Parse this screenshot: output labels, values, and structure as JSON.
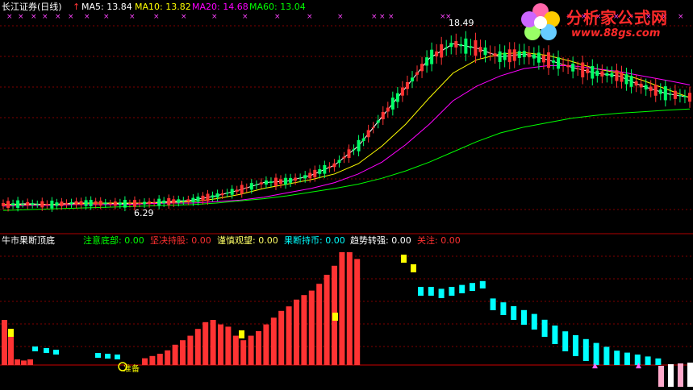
{
  "main_panel": {
    "stock_title": "长江证券(日线)",
    "indicators": [
      {
        "label": "MA5: 13.84",
        "color": "#ffffff"
      },
      {
        "label": "MA10: 13.82",
        "color": "#ffff00"
      },
      {
        "label": "MA20: 14.68",
        "color": "#ff00ff"
      },
      {
        "label": "MA60: 13.04",
        "color": "#00ff00"
      }
    ],
    "high_marker": "18.49",
    "low_marker": "6.29"
  },
  "sub_panel": {
    "title": "牛市果断顶底",
    "values": [
      {
        "label": "注意底部: 0.00",
        "color": "#00ff00"
      },
      {
        "label": "坚决持股: 0.00",
        "color": "#ff3030"
      },
      {
        "label": "谨慎观望: 0.00",
        "color": "#ffff66"
      },
      {
        "label": "果断持币: 0.00",
        "color": "#00ffff"
      },
      {
        "label": "趋势转强: 0.00",
        "color": "#ffffff"
      },
      {
        "label": "关注: 0.00",
        "color": "#ff3030"
      }
    ],
    "annotation": "准备"
  },
  "watermark": {
    "site_name": "分析家公式网",
    "url": "www.88gs.com"
  },
  "colors": {
    "up": "#ff3333",
    "down": "#00ffff",
    "yellow": "#ffff00",
    "grid": "#800000",
    "ma5": "#ffffff",
    "ma10": "#ffff00",
    "ma20": "#ff00ff",
    "ma60": "#00ff00"
  },
  "chart_data": [
    {
      "type": "candlestick",
      "title": "长江证券(日线)",
      "series": [
        {
          "name": "MA5",
          "values": [
            6.5,
            6.55,
            6.5,
            6.6,
            6.6,
            6.55,
            6.6,
            6.7,
            6.8,
            7.1,
            7.5,
            8.0,
            8.1,
            8.5,
            9.2,
            10.5,
            12.5,
            14.5,
            16.5,
            17.5,
            17.2,
            16.6,
            16.8,
            16.4,
            15.9,
            15.5,
            15.3,
            14.6,
            14.1,
            13.84
          ]
        },
        {
          "name": "MA10",
          "values": [
            6.5,
            6.5,
            6.5,
            6.55,
            6.6,
            6.6,
            6.6,
            6.65,
            6.7,
            6.9,
            7.2,
            7.6,
            7.9,
            8.2,
            8.6,
            9.3,
            10.5,
            12.0,
            13.8,
            15.5,
            16.4,
            16.8,
            16.9,
            16.7,
            16.3,
            15.8,
            15.5,
            15.0,
            14.4,
            13.82
          ]
        },
        {
          "name": "MA20",
          "values": [
            6.4,
            6.45,
            6.45,
            6.5,
            6.5,
            6.5,
            6.55,
            6.6,
            6.6,
            6.7,
            6.8,
            7.0,
            7.3,
            7.6,
            8.0,
            8.6,
            9.4,
            10.6,
            12.0,
            13.6,
            14.6,
            15.3,
            15.8,
            16.0,
            16.0,
            15.8,
            15.6,
            15.3,
            15.0,
            14.68
          ]
        },
        {
          "name": "MA60",
          "values": [
            6.1,
            6.15,
            6.2,
            6.25,
            6.3,
            6.35,
            6.4,
            6.45,
            6.5,
            6.6,
            6.75,
            6.9,
            7.1,
            7.35,
            7.6,
            7.9,
            8.3,
            8.8,
            9.4,
            10.1,
            10.8,
            11.4,
            11.8,
            12.1,
            12.4,
            12.6,
            12.75,
            12.85,
            12.95,
            13.04
          ]
        }
      ],
      "annotations": [
        {
          "text": "18.49",
          "kind": "high"
        },
        {
          "text": "6.29",
          "kind": "low"
        }
      ]
    },
    {
      "type": "bar",
      "title": "牛市果断顶底",
      "red_bars": [
        0.4,
        0.3,
        0.05,
        0.04,
        0.05,
        0.06,
        0.08,
        0.1,
        0.13,
        0.18,
        0.22,
        0.26,
        0.32,
        0.38,
        0.4,
        0.36,
        0.34,
        0.26,
        0.22,
        0.26,
        0.3,
        0.36,
        0.42,
        0.48,
        0.52,
        0.58,
        0.62,
        0.66,
        0.72,
        0.8,
        0.88,
        1.0,
        1.0,
        0.94
      ],
      "cyan_bars": [
        0.1,
        0.1,
        0.12,
        0.1,
        0.08,
        0.06,
        0.04,
        0.22,
        0.26,
        0.3,
        0.34,
        0.38,
        0.44,
        0.5,
        0.56,
        0.6,
        0.64,
        0.68,
        0.72,
        0.76,
        0.78,
        0.8,
        0.82,
        0.84
      ],
      "yellow_tops": [
        0.06,
        0.08,
        0.1,
        0.12,
        0.14
      ],
      "annotations": [
        {
          "text": "准备"
        }
      ]
    }
  ]
}
